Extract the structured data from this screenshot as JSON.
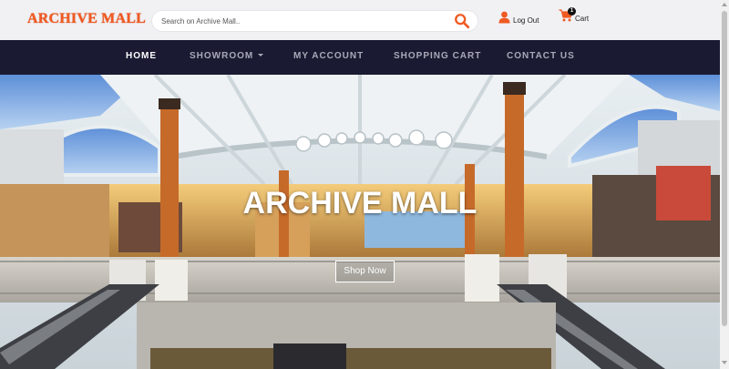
{
  "header": {
    "logo": "ARCHIVE MALL",
    "search_placeholder": "Search on Archive Mall..",
    "logout_label": "Log Out",
    "cart_label": "Cart",
    "cart_count": "1"
  },
  "nav": {
    "items": [
      {
        "label": "HOME",
        "active": true
      },
      {
        "label": "SHOWROOM",
        "dropdown": true
      },
      {
        "label": "MY ACCOUNT"
      },
      {
        "label": "SHOPPING CART"
      },
      {
        "label": "CONTACT US"
      }
    ]
  },
  "hero": {
    "title": "ARCHIVE MALL",
    "button_label": "Shop Now"
  },
  "colors": {
    "brand": "#f05a22",
    "nav_background": "#1a1b33",
    "header_background": "#f1f1f4"
  },
  "icons": [
    "search-icon",
    "user-icon",
    "cart-icon",
    "chevron-down-icon"
  ]
}
